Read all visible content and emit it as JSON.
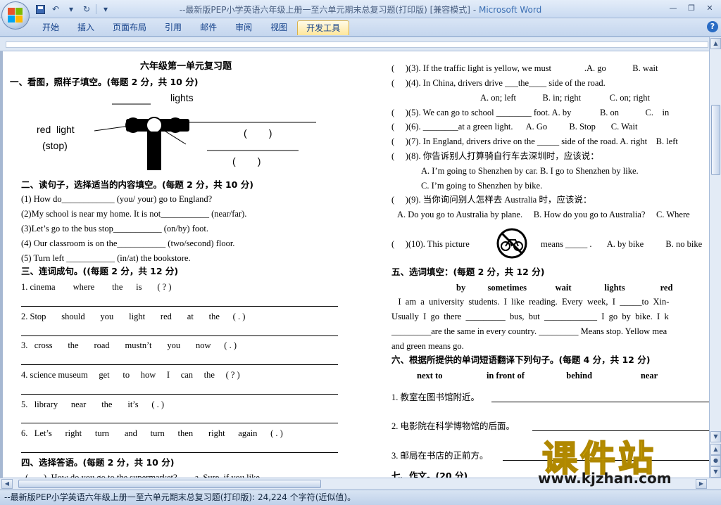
{
  "window": {
    "title": "--最新版PEP小学英语六年级上册一至六单元期末总复习题(打印版) [兼容模式]",
    "title_sep": " - ",
    "app_name": "Microsoft Word"
  },
  "ribbon": {
    "tabs": [
      "开始",
      "插入",
      "页面布局",
      "引用",
      "邮件",
      "审阅",
      "视图",
      "开发工具"
    ],
    "active_tab": "开发工具"
  },
  "doc": {
    "left": {
      "title": "六年级第一单元复习题",
      "s1_heading": "一、看图，照样子填空。(每题 2 分，共 10 分)",
      "pic": {
        "lights": "lights",
        "red_light": "red  light",
        "stop": "(stop)",
        "paren1": "(        )",
        "paren2": "(        )"
      },
      "s2_heading": "二、读句子，选择适当的内容填空。(每题 2 分，共 10 分)",
      "s2_items": [
        "(1) How do____________ (you/ your) go to England?",
        "(2)My school is near my home. It is not___________ (near/far).",
        "(3)Let’s go to the bus stop___________ (on/by) foot.",
        "(4) Our classroom is on the___________ (two/second) floor.",
        "(5) Turn left ___________ (in/at) the bookstore."
      ],
      "s3_heading": "三、连词成句。((每题 2 分，共 12 分)",
      "s3_items": [
        "1. cinema        where        the      is       ( ? )",
        "2. Stop       should       you       light       red       at       the      ( . )",
        "3.   cross       the       road       mustn’t       you       now      ( . )",
        "4. science museum     get      to     how     I     can     the     ( ? )",
        "5.   library      near       the       it’s      ( . )",
        "6.   Let’s      right      turn       and      turn      then       right      again      ( . )"
      ],
      "s4_heading": "四、选择答语。(每题 2 分，共 10 分)",
      "s4_partial": "(       )  How do you go to the supermarket?        a. Sure, if you like."
    },
    "right": {
      "q3": "(     )(3). If the traffic light is yellow, we must               .A. go            B. wait",
      "q4": "(     )(4). In China, drivers drive ___the____ side of the road.",
      "q4_opts": "A. on; left            B. in; right             C. on; right",
      "q5": "(     )(5). We can go to school ________ foot. A. by             B. on            C.    in",
      "q6": "(     )(6). ________at a green light.      A. Go          B. Stop       C. Wait",
      "q7": "(     )(7). In England, drivers drive on the _____ side of the road. A. right    B. left",
      "q8": "(     )(8). 你告诉别人打算骑自行车去深圳时，应该说：",
      "q8_a": "A. I’m going to Shenzhen by car. B. I go to Shenzhen by like.",
      "q8_c": "C. I’m going to Shenzhen by bike.",
      "q9": "(     )(9). 当你询问别人怎样去 Australia 时，应该说：",
      "q9_opts": "A. Do you go to Australia by plane.     B. How do you go to Australia?     C. Where",
      "q10_a": "(     )(10). This picture",
      "q10_b": "means _____ .       A. by bike          B. no bike",
      "s5_heading": "五、选词填空：(每题 2 分，共 12 分)",
      "s5_words": "by          sometimes             wait               lights                red",
      "s5_p1": "   I  am  a  university  students.  I  like  reading.  Every  week,  I  _____to  Xin-",
      "s5_p2": "Usually  I  go  there  _________  bus,  but  ____________  I  go  by  bike.  I  k",
      "s5_p3": "_________are the same in every country. _________ Means stop. Yellow mea",
      "s5_p4": "and green means go.",
      "s6_heading": "六、根据所提供的单词短语翻译下列句子。(每题 4 分，共 12 分)",
      "s6_words": "next to                    in front of                   behind                      near",
      "s6_items": [
        "1. 教室在图书馆附近。",
        "2. 电影院在科学博物馆的后面。",
        "3. 邮局在书店的正前方。"
      ],
      "s7_heading": "七、作文。(20 分)"
    }
  },
  "status": {
    "text": "--最新版PEP小学英语六年级上册一至六单元期末总复习题(打印版): 24,224 个字符(近似值)。"
  },
  "watermark": {
    "cn": "课件站",
    "url": "www.kjzhan.com"
  },
  "colors": {
    "titlebar": "#c9daf1",
    "app_name": "#3b6fb3",
    "watermark_yellow": "#ffd400"
  }
}
